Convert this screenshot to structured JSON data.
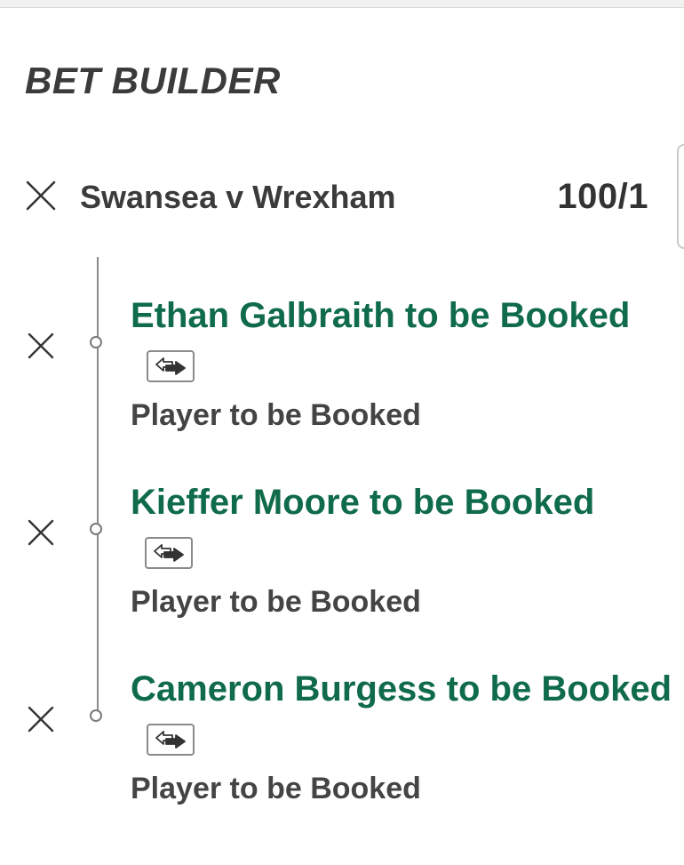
{
  "panel": {
    "title": "BET BUILDER"
  },
  "event": {
    "name": "Swansea v Wrexham",
    "odds": "100/1"
  },
  "selections": [
    {
      "name": "Ethan Galbraith to be Booked",
      "market": "Player to be Booked"
    },
    {
      "name": "Kieffer Moore to be Booked",
      "market": "Player to be Booked"
    },
    {
      "name": "Cameron Burgess to be Booked",
      "market": "Player to be Booked"
    }
  ],
  "icons": {
    "remove": "close-icon",
    "swap": "swap-selection-icon"
  },
  "colors": {
    "selection_green": "#0f6b4a",
    "text_dark": "#3b3b3b"
  }
}
